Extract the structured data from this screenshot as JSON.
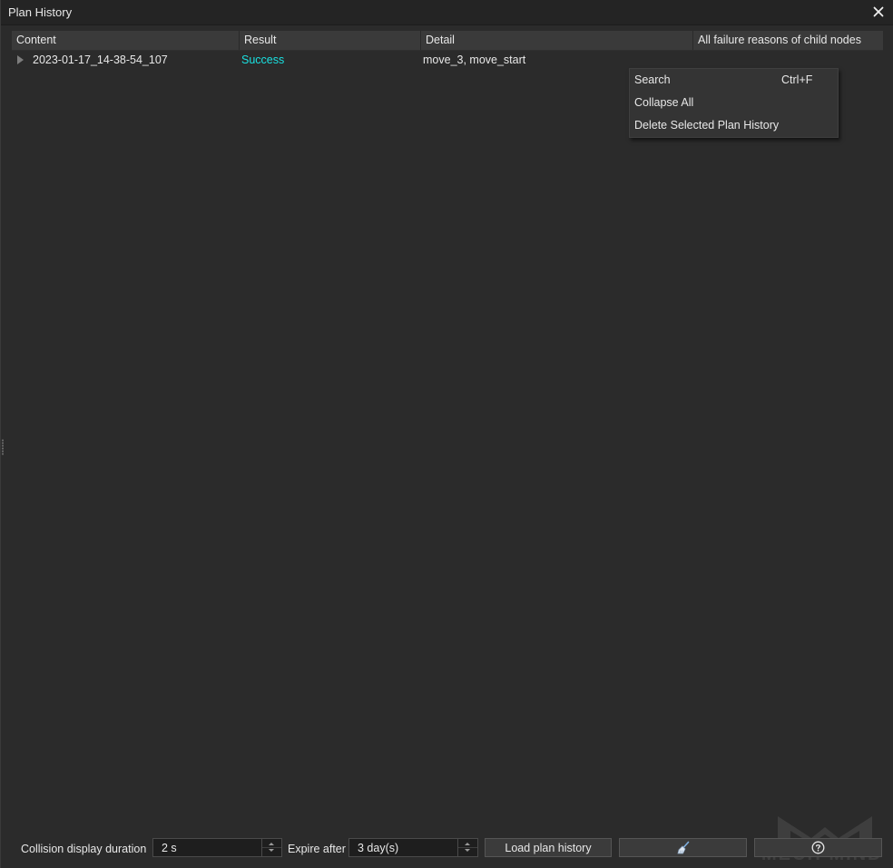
{
  "window": {
    "title": "Plan History"
  },
  "table": {
    "columns": [
      "Content",
      "Result",
      "Detail",
      "All failure reasons of child nodes"
    ],
    "rows": [
      {
        "content": "2023-01-17_14-38-54_107",
        "result": "Success",
        "detail": "move_3, move_start",
        "failure_reasons": ""
      }
    ]
  },
  "context_menu": {
    "items": [
      {
        "label": "Search",
        "shortcut": "Ctrl+F"
      },
      {
        "label": "Collapse All",
        "shortcut": ""
      },
      {
        "label": "Delete Selected Plan History",
        "shortcut": ""
      }
    ]
  },
  "bottom_bar": {
    "collision_label": "Collision display duration",
    "collision_value": "2 s",
    "expire_label": "Expire after",
    "expire_value": "3 day(s)",
    "load_button": "Load plan history",
    "clear_icon": "broom-icon",
    "help_icon": "question-circle-icon"
  },
  "watermark": {
    "text": "MECH MIND"
  },
  "colors": {
    "success": "#19e0e0",
    "background": "#2b2b2b"
  }
}
